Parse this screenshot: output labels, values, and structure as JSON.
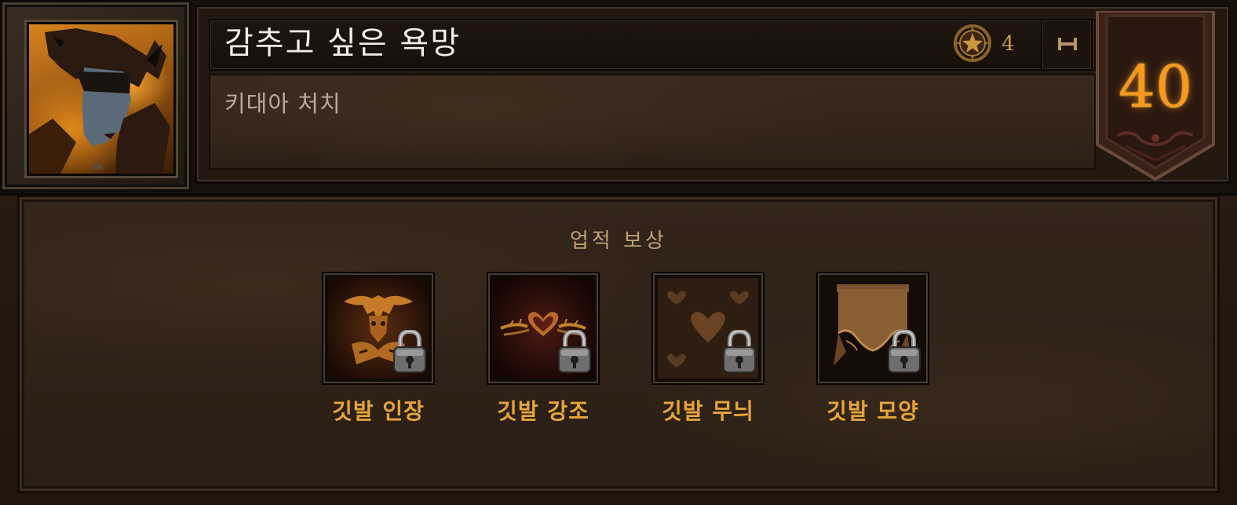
{
  "achievement": {
    "title": "감추고 싶은 욕망",
    "description": "키대아 처치",
    "points": "4",
    "level": "40",
    "portrait_icon": "demon-woman-portrait",
    "points_icon": "achievement-star-icon",
    "pin_icon": "pin-icon"
  },
  "rewards": {
    "heading": "업적 보상",
    "items": [
      {
        "label": "깃발 인장",
        "icon": "banner-sigil-icon",
        "locked": true
      },
      {
        "label": "깃발 강조",
        "icon": "banner-accent-icon",
        "locked": true
      },
      {
        "label": "깃발 무늬",
        "icon": "banner-pattern-icon",
        "locked": true
      },
      {
        "label": "깃발 모양",
        "icon": "banner-shape-icon",
        "locked": true
      }
    ]
  },
  "colors": {
    "title": "#f2ece4",
    "description": "#b5aaa0",
    "points": "#c89a52",
    "level": "#f59a1e",
    "reward_label": "#e6a43a",
    "heading": "#c2a178"
  }
}
